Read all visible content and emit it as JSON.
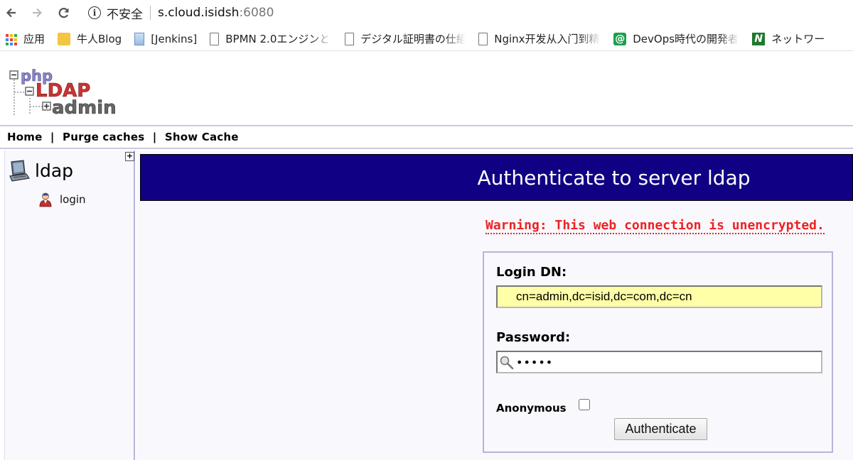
{
  "browser": {
    "security_label": "不安全",
    "url_host": "s.cloud.isidsh",
    "url_port": ":6080",
    "bookmarks": [
      {
        "label": "应用",
        "icon": "apps-grid-icon"
      },
      {
        "label": "牛人Blog",
        "icon": "folder-icon"
      },
      {
        "label": "[Jenkins]",
        "icon": "document-icon"
      },
      {
        "label": "BPMN 2.0エンジンと",
        "icon": "page-icon"
      },
      {
        "label": "デジタル証明書の仕組",
        "icon": "page-icon"
      },
      {
        "label": "Nginx开发从入门到精",
        "icon": "page-icon"
      },
      {
        "label": "DevOps時代の開発者",
        "icon": "at-sign-icon"
      },
      {
        "label": "ネットワー",
        "icon": "n-logo-icon"
      }
    ]
  },
  "app": {
    "logo_alt": "phpLDAPadmin",
    "logo_parts": [
      "php",
      "LDAP",
      "admin"
    ],
    "menu": {
      "home": "Home",
      "sep": "|",
      "purge": "Purge caches",
      "show_cache": "Show Cache"
    },
    "sidebar": {
      "expand": "+",
      "server_name": "ldap",
      "login_label": "login"
    },
    "title": "Authenticate to server ldap",
    "warning": "Warning: This web connection is unencrypted.",
    "form": {
      "dn_label": "Login DN:",
      "dn_value": "cn=admin,dc=isid,dc=com,dc=cn",
      "password_label": "Password:",
      "password_value": "•••••",
      "anonymous_label": "Anonymous",
      "anonymous_checked": false,
      "submit_label": "Authenticate"
    }
  },
  "colors": {
    "title_bar": "#100083",
    "warning": "#ee2222",
    "dn_bg": "#ffffa8",
    "panel_bg": "#f8f8fd"
  }
}
